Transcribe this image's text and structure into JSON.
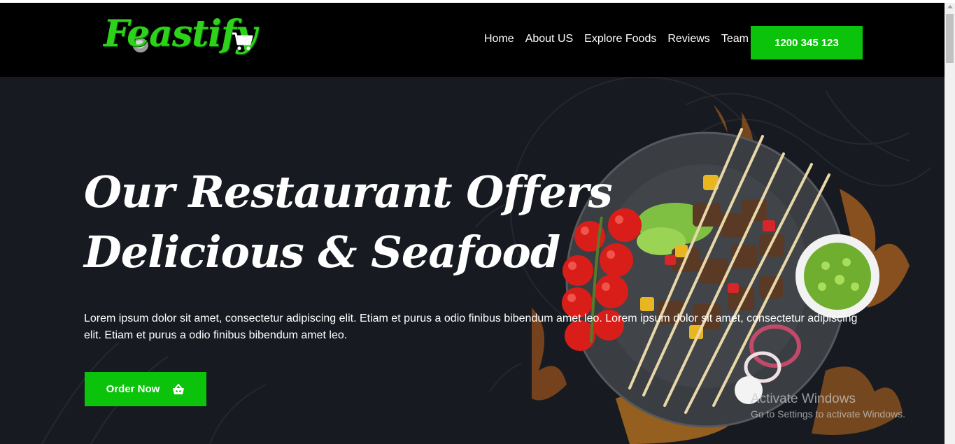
{
  "brand": {
    "logo_text": "Feastify",
    "accent": "#0bc30b",
    "logo_color": "#2fd21b"
  },
  "header": {
    "cart_icon": "shopping-cart-icon",
    "nav": [
      {
        "label": "Home"
      },
      {
        "label": "About US"
      },
      {
        "label": "Explore Foods"
      },
      {
        "label": "Reviews"
      },
      {
        "label": "Team"
      }
    ],
    "phone_label": "1200 345 123"
  },
  "hero": {
    "title": "Our Restaurant Offers Delicious & Seafood",
    "text": "Lorem ipsum dolor sit amet, consectetur adipiscing elit. Etiam et purus a odio finibus bibendum amet leo. Lorem ipsum dolor sit amet, consectetur adipiscing elit. Etiam et purus a odio finibus bibendum amet leo.",
    "order_label": "Order Now",
    "order_icon": "basket-icon"
  },
  "watermark": {
    "title": "Activate Windows",
    "subtitle": "Go to Settings to activate Windows."
  },
  "colors": {
    "nav_bg": "#000000",
    "hero_bg": "#171b21"
  }
}
